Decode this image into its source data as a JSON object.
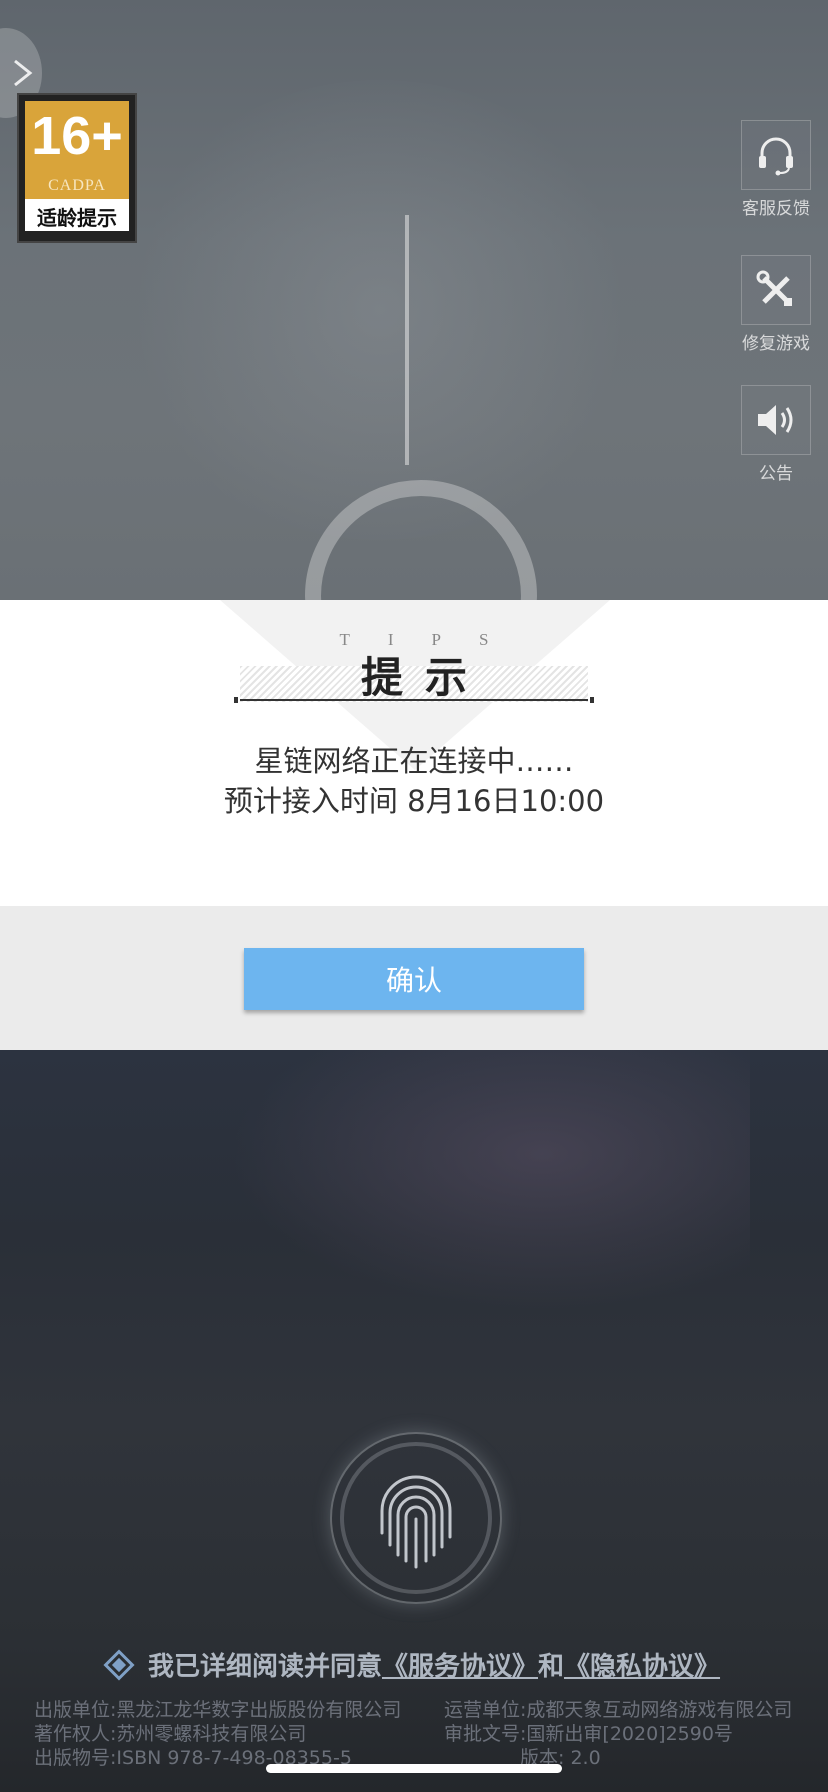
{
  "age_rating": {
    "number": "16+",
    "org": "CADPA",
    "label": "适龄提示"
  },
  "side_menu": [
    {
      "label": "客服反馈",
      "icon": "headset-icon"
    },
    {
      "label": "修复游戏",
      "icon": "tools-icon"
    },
    {
      "label": "公告",
      "icon": "speaker-icon"
    }
  ],
  "dialog": {
    "tips_en": "TIPS",
    "title": "提示",
    "line1": "星链网络正在连接中……",
    "line2": "预计接入时间  8月16日10:00",
    "confirm_label": "确认"
  },
  "agreement": {
    "prefix": "我已详细阅读并同意",
    "service_link": "《服务协议》",
    "conj": "和",
    "privacy_link": "《隐私协议》"
  },
  "publisher": {
    "line1_left": "出版单位:黑龙江龙华数字出版股份有限公司",
    "line1_right": "运营单位:成都天象互动网络游戏有限公司",
    "line2_left": "著作权人:苏州零螺科技有限公司",
    "line2_right": "审批文号:国新出审[2020]2590号",
    "line3_left": "出版物号:ISBN 978-7-498-08355-5",
    "line3_right": "版本: 2.0"
  },
  "colors": {
    "confirm_button": "#6db5ef",
    "badge_gold": "#d9a43a",
    "accent_diamond": "#7fa0c6"
  }
}
